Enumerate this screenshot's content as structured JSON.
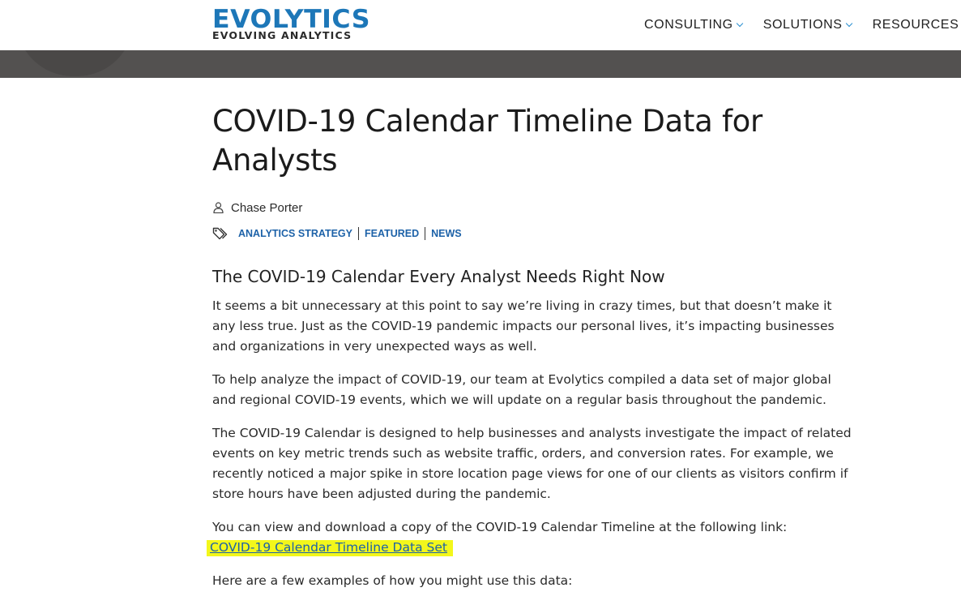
{
  "header": {
    "logo_main": "EVOLYTICS",
    "logo_sub": "EVOLVING ANALYTICS",
    "nav": [
      {
        "label": "CONSULTING"
      },
      {
        "label": "SOLUTIONS"
      },
      {
        "label": "RESOURCES"
      }
    ]
  },
  "article": {
    "title": "COVID-19 Calendar Timeline Data for Analysts",
    "author": "Chase Porter",
    "tags": [
      "ANALYTICS STRATEGY",
      "FEATURED",
      "NEWS"
    ],
    "subheading": "The COVID-19 Calendar Every Analyst Needs Right Now",
    "paragraphs": [
      "It seems a bit unnecessary at this point to say we’re living in crazy times, but that doesn’t make it any less true. Just as the COVID-19 pandemic impacts our personal lives, it’s impacting businesses and organizations in very unexpected ways as well.",
      "To help analyze the impact of COVID-19, our team at Evolytics compiled a data set of major global and regional COVID-19 events, which we will update on a regular basis throughout the pandemic.",
      "The COVID-19 Calendar is designed to help businesses and analysts investigate the impact of related events on key metric trends such as website traffic, orders, and conversion rates. For example, we recently noticed a major spike in store location page views for one of our clients as visitors confirm if store hours have been adjusted during the pandemic.",
      "You can view and download a copy of the COVID-19 Calendar Timeline at the following link:",
      "Here are a few examples of how you might use this data:"
    ],
    "download_link": "COVID-19 Calendar Timeline Data Set"
  },
  "colors": {
    "brand_blue": "#1d77b8",
    "link_blue": "#1d62a8",
    "highlight": "#f3f71b",
    "band": "#535150"
  }
}
